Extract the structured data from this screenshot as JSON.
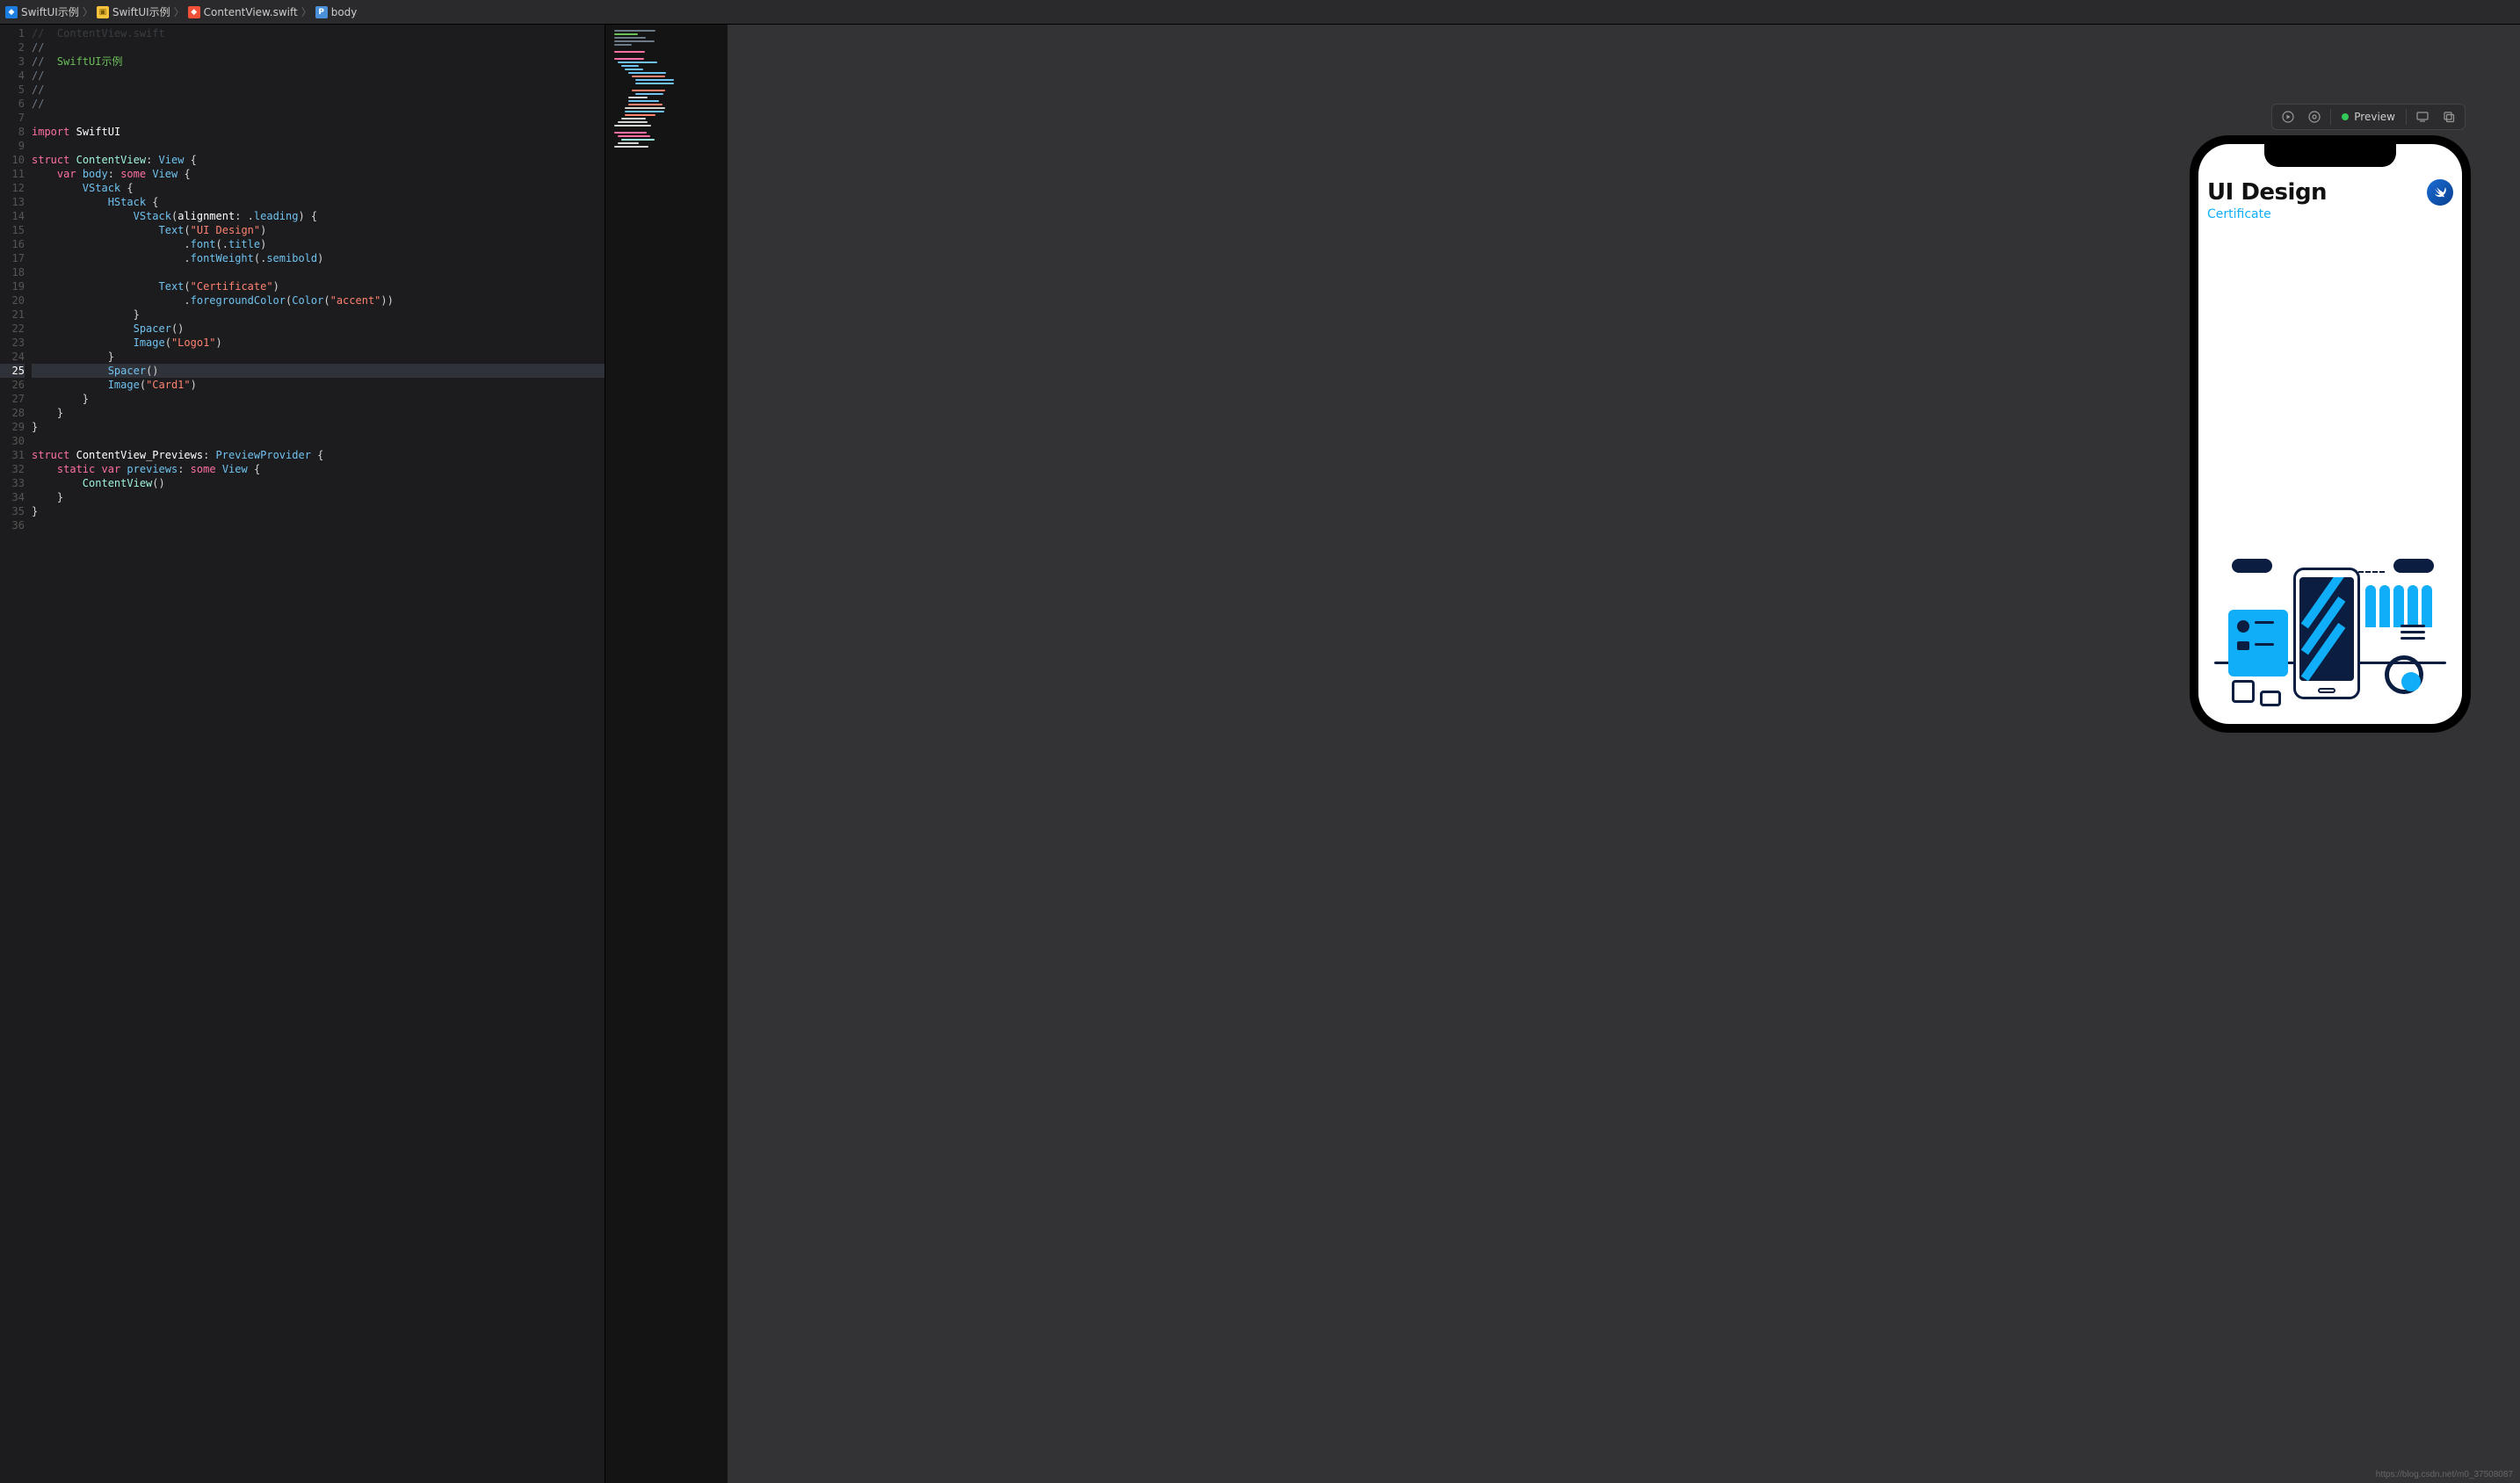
{
  "breadcrumb": [
    {
      "icon": "proj",
      "label": "SwiftUI示例"
    },
    {
      "icon": "folder",
      "label": "SwiftUI示例"
    },
    {
      "icon": "swift",
      "label": "ContentView.swift"
    },
    {
      "icon": "prop",
      "label": "body"
    }
  ],
  "editor": {
    "highlighted_line": 25,
    "lines": [
      {
        "n": 1,
        "tokens": [
          {
            "c": "tok-comment",
            "t": "//  ContentView.swift"
          }
        ],
        "dim": true
      },
      {
        "n": 2,
        "tokens": [
          {
            "c": "tok-comment",
            "t": "//"
          }
        ]
      },
      {
        "n": 3,
        "tokens": [
          {
            "c": "tok-comment",
            "t": "//  "
          },
          {
            "c": "tok-commentg",
            "t": "SwiftUI示例"
          }
        ]
      },
      {
        "n": 4,
        "tokens": [
          {
            "c": "tok-comment",
            "t": "//"
          }
        ]
      },
      {
        "n": 5,
        "tokens": [
          {
            "c": "tok-comment",
            "t": "//"
          }
        ]
      },
      {
        "n": 6,
        "tokens": [
          {
            "c": "tok-comment",
            "t": "//"
          }
        ]
      },
      {
        "n": 7,
        "tokens": []
      },
      {
        "n": 8,
        "tokens": [
          {
            "c": "tok-keyword",
            "t": "import"
          },
          {
            "c": "tok-punct",
            "t": " "
          },
          {
            "c": "tok-white",
            "t": "SwiftUI"
          }
        ]
      },
      {
        "n": 9,
        "tokens": []
      },
      {
        "n": 10,
        "tokens": [
          {
            "c": "tok-keyword",
            "t": "struct"
          },
          {
            "c": "tok-punct",
            "t": " "
          },
          {
            "c": "tok-typeref",
            "t": "ContentView"
          },
          {
            "c": "tok-punct",
            "t": ": "
          },
          {
            "c": "tok-type",
            "t": "View"
          },
          {
            "c": "tok-punct",
            "t": " {"
          }
        ]
      },
      {
        "n": 11,
        "tokens": [
          {
            "c": "tok-punct",
            "t": "    "
          },
          {
            "c": "tok-keyword",
            "t": "var"
          },
          {
            "c": "tok-punct",
            "t": " "
          },
          {
            "c": "tok-type",
            "t": "body"
          },
          {
            "c": "tok-punct",
            "t": ": "
          },
          {
            "c": "tok-keyword",
            "t": "some"
          },
          {
            "c": "tok-punct",
            "t": " "
          },
          {
            "c": "tok-type",
            "t": "View"
          },
          {
            "c": "tok-punct",
            "t": " {"
          }
        ]
      },
      {
        "n": 12,
        "tokens": [
          {
            "c": "tok-punct",
            "t": "        "
          },
          {
            "c": "tok-type",
            "t": "VStack"
          },
          {
            "c": "tok-punct",
            "t": " {"
          }
        ]
      },
      {
        "n": 13,
        "tokens": [
          {
            "c": "tok-punct",
            "t": "            "
          },
          {
            "c": "tok-type",
            "t": "HStack"
          },
          {
            "c": "tok-punct",
            "t": " {"
          }
        ]
      },
      {
        "n": 14,
        "tokens": [
          {
            "c": "tok-punct",
            "t": "                "
          },
          {
            "c": "tok-type",
            "t": "VStack"
          },
          {
            "c": "tok-punct",
            "t": "("
          },
          {
            "c": "tok-white",
            "t": "alignment"
          },
          {
            "c": "tok-punct",
            "t": ": ."
          },
          {
            "c": "tok-type",
            "t": "leading"
          },
          {
            "c": "tok-punct",
            "t": ") {"
          }
        ]
      },
      {
        "n": 15,
        "tokens": [
          {
            "c": "tok-punct",
            "t": "                    "
          },
          {
            "c": "tok-type",
            "t": "Text"
          },
          {
            "c": "tok-punct",
            "t": "("
          },
          {
            "c": "tok-string",
            "t": "\"UI Design\""
          },
          {
            "c": "tok-punct",
            "t": ")"
          }
        ]
      },
      {
        "n": 16,
        "tokens": [
          {
            "c": "tok-punct",
            "t": "                        ."
          },
          {
            "c": "tok-type",
            "t": "font"
          },
          {
            "c": "tok-punct",
            "t": "(."
          },
          {
            "c": "tok-type",
            "t": "title"
          },
          {
            "c": "tok-punct",
            "t": ")"
          }
        ]
      },
      {
        "n": 17,
        "tokens": [
          {
            "c": "tok-punct",
            "t": "                        ."
          },
          {
            "c": "tok-type",
            "t": "fontWeight"
          },
          {
            "c": "tok-punct",
            "t": "(."
          },
          {
            "c": "tok-type",
            "t": "semibold"
          },
          {
            "c": "tok-punct",
            "t": ")"
          }
        ]
      },
      {
        "n": 18,
        "tokens": []
      },
      {
        "n": 19,
        "tokens": [
          {
            "c": "tok-punct",
            "t": "                    "
          },
          {
            "c": "tok-type",
            "t": "Text"
          },
          {
            "c": "tok-punct",
            "t": "("
          },
          {
            "c": "tok-string",
            "t": "\"Certificate\""
          },
          {
            "c": "tok-punct",
            "t": ")"
          }
        ]
      },
      {
        "n": 20,
        "tokens": [
          {
            "c": "tok-punct",
            "t": "                        ."
          },
          {
            "c": "tok-type",
            "t": "foregroundColor"
          },
          {
            "c": "tok-punct",
            "t": "("
          },
          {
            "c": "tok-type",
            "t": "Color"
          },
          {
            "c": "tok-punct",
            "t": "("
          },
          {
            "c": "tok-string",
            "t": "\"accent\""
          },
          {
            "c": "tok-punct",
            "t": "))"
          }
        ]
      },
      {
        "n": 21,
        "tokens": [
          {
            "c": "tok-punct",
            "t": "                }"
          }
        ]
      },
      {
        "n": 22,
        "tokens": [
          {
            "c": "tok-punct",
            "t": "                "
          },
          {
            "c": "tok-type",
            "t": "Spacer"
          },
          {
            "c": "tok-punct",
            "t": "()"
          }
        ]
      },
      {
        "n": 23,
        "tokens": [
          {
            "c": "tok-punct",
            "t": "                "
          },
          {
            "c": "tok-type",
            "t": "Image"
          },
          {
            "c": "tok-punct",
            "t": "("
          },
          {
            "c": "tok-string",
            "t": "\"Logo1\""
          },
          {
            "c": "tok-punct",
            "t": ")"
          }
        ]
      },
      {
        "n": 24,
        "tokens": [
          {
            "c": "tok-punct",
            "t": "            }"
          }
        ]
      },
      {
        "n": 25,
        "tokens": [
          {
            "c": "tok-punct",
            "t": "            "
          },
          {
            "c": "tok-type",
            "t": "Spacer"
          },
          {
            "c": "tok-punct",
            "t": "()"
          }
        ]
      },
      {
        "n": 26,
        "tokens": [
          {
            "c": "tok-punct",
            "t": "            "
          },
          {
            "c": "tok-type",
            "t": "Image"
          },
          {
            "c": "tok-punct",
            "t": "("
          },
          {
            "c": "tok-string",
            "t": "\"Card1\""
          },
          {
            "c": "tok-punct",
            "t": ")"
          }
        ]
      },
      {
        "n": 27,
        "tokens": [
          {
            "c": "tok-punct",
            "t": "        }"
          }
        ]
      },
      {
        "n": 28,
        "tokens": [
          {
            "c": "tok-punct",
            "t": "    }"
          }
        ]
      },
      {
        "n": 29,
        "tokens": [
          {
            "c": "tok-punct",
            "t": "}"
          }
        ]
      },
      {
        "n": 30,
        "tokens": []
      },
      {
        "n": 31,
        "tokens": [
          {
            "c": "tok-keyword",
            "t": "struct"
          },
          {
            "c": "tok-punct",
            "t": " "
          },
          {
            "c": "tok-white",
            "t": "ContentView_Previews"
          },
          {
            "c": "tok-punct",
            "t": ": "
          },
          {
            "c": "tok-type",
            "t": "PreviewProvider"
          },
          {
            "c": "tok-punct",
            "t": " {"
          }
        ]
      },
      {
        "n": 32,
        "tokens": [
          {
            "c": "tok-punct",
            "t": "    "
          },
          {
            "c": "tok-keyword",
            "t": "static"
          },
          {
            "c": "tok-punct",
            "t": " "
          },
          {
            "c": "tok-keyword",
            "t": "var"
          },
          {
            "c": "tok-punct",
            "t": " "
          },
          {
            "c": "tok-type",
            "t": "previews"
          },
          {
            "c": "tok-punct",
            "t": ": "
          },
          {
            "c": "tok-keyword",
            "t": "some"
          },
          {
            "c": "tok-punct",
            "t": " "
          },
          {
            "c": "tok-type",
            "t": "View"
          },
          {
            "c": "tok-punct",
            "t": " {"
          }
        ]
      },
      {
        "n": 33,
        "tokens": [
          {
            "c": "tok-punct",
            "t": "        "
          },
          {
            "c": "tok-typeref",
            "t": "ContentView"
          },
          {
            "c": "tok-punct",
            "t": "()"
          }
        ]
      },
      {
        "n": 34,
        "tokens": [
          {
            "c": "tok-punct",
            "t": "    }"
          }
        ]
      },
      {
        "n": 35,
        "tokens": [
          {
            "c": "tok-punct",
            "t": "}"
          }
        ]
      },
      {
        "n": 36,
        "tokens": []
      }
    ]
  },
  "preview_toolbar": {
    "label": "Preview"
  },
  "phone": {
    "title": "UI Design",
    "subtitle": "Certificate",
    "logo_alt": "swift-bird-icon"
  },
  "watermark": "https://blog.csdn.net/m0_37508087"
}
